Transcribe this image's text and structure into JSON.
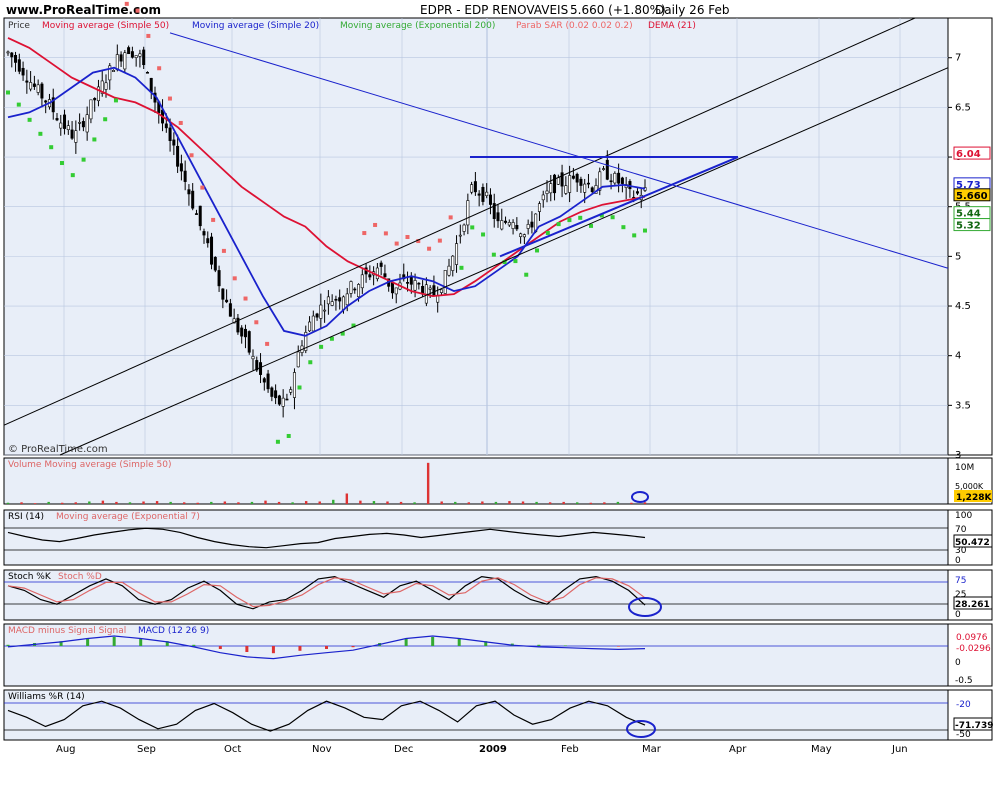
{
  "header": {
    "site": "www.ProRealTime.com",
    "title": "EDPR - EDP RENOVAVEIS",
    "quote": "5.660 (+1.80%)",
    "period": "Daily  26 Feb"
  },
  "legend": {
    "price": "Price",
    "sma50": "Moving average (Simple 50)",
    "sma20": "Moving average (Simple 20)",
    "ema200": "Moving average (Exponential 200)",
    "sar": "Parab SAR (0.02 0.02 0.2)",
    "dema": "DEMA (21)"
  },
  "colors": {
    "panel_bg": "#e8eef8",
    "grid": "#b8c6e0",
    "up_candle": "#ffffff",
    "down_candle": "#000000",
    "sma50": "#dd1133",
    "sma20": "#1a22cc",
    "sar_up": "#33cc33",
    "sar_down": "#ee6666",
    "trend_blue": "#1a22cc",
    "label_price": "#ffcc00"
  },
  "watermark": "© ProRealTime.com",
  "chart_data": [
    {
      "type": "candlestick",
      "panel": "price",
      "x": [
        "Aug",
        "Sep",
        "Oct",
        "Nov",
        "Dec",
        "2009",
        "Feb",
        "Mar",
        "Apr",
        "May",
        "Jun"
      ],
      "ylim": [
        3,
        7.4
      ],
      "yticks": [
        3,
        3.5,
        4,
        4.5,
        5,
        5.5,
        6,
        6.5,
        7
      ],
      "close_path": [
        7.05,
        6.9,
        6.7,
        6.55,
        6.35,
        6.2,
        6.45,
        6.7,
        6.95,
        7.1,
        7.0,
        6.6,
        6.2,
        5.9,
        5.5,
        5.1,
        4.7,
        4.35,
        4.1,
        3.8,
        3.55,
        3.5,
        4.1,
        4.4,
        4.55,
        4.6,
        4.7,
        4.8,
        4.9,
        4.65,
        4.75,
        4.7,
        4.6,
        4.8,
        5.2,
        5.7,
        5.6,
        5.3,
        5.4,
        5.2,
        5.5,
        5.7,
        5.75,
        5.8,
        5.7,
        5.85,
        5.75,
        5.6,
        5.66
      ],
      "series": [
        {
          "name": "Moving average (Simple 50)",
          "values": [
            7.2,
            7.1,
            6.95,
            6.8,
            6.7,
            6.6,
            6.55,
            6.45,
            6.3,
            6.1,
            5.9,
            5.7,
            5.55,
            5.4,
            5.3,
            5.1,
            4.95,
            4.85,
            4.75,
            4.65,
            4.6,
            4.62,
            4.75,
            4.9,
            5.05,
            5.2,
            5.35,
            5.45,
            5.52,
            5.56,
            5.6
          ]
        },
        {
          "name": "Moving average (Simple 20)",
          "values": [
            6.4,
            6.45,
            6.55,
            6.7,
            6.85,
            6.9,
            6.8,
            6.6,
            6.2,
            5.8,
            5.4,
            5.0,
            4.6,
            4.25,
            4.2,
            4.3,
            4.5,
            4.65,
            4.75,
            4.8,
            4.75,
            4.65,
            4.7,
            4.85,
            5.0,
            5.3,
            5.4,
            5.55,
            5.7,
            5.72,
            5.68
          ]
        },
        {
          "name": "Parab SAR (0.02 0.02 0.2)",
          "values": []
        }
      ],
      "trend_lines": [
        {
          "name": "horizontal-resistance",
          "value": 6.0
        },
        {
          "name": "descending-resistance",
          "from": 7.2,
          "to": 4.9
        }
      ],
      "price_labels": [
        "6.04",
        "5.73",
        "5.660",
        "5.44",
        "5.32"
      ]
    },
    {
      "type": "bar",
      "panel": "volume",
      "title": "Volume Moving average (Simple 50)",
      "yticks": [
        "10M",
        "5,000K"
      ],
      "last_label": "1,228K",
      "values": [
        0.3,
        0.4,
        0.2,
        0.5,
        0.3,
        0.4,
        0.6,
        0.8,
        0.5,
        0.4,
        0.6,
        0.7,
        0.5,
        0.4,
        0.3,
        0.5,
        0.6,
        0.4,
        0.5,
        0.8,
        0.5,
        0.4,
        0.7,
        0.6,
        1.0,
        2.5,
        0.8,
        0.7,
        0.6,
        0.5,
        0.4,
        9.8,
        0.6,
        0.5,
        0.4,
        0.6,
        0.5,
        0.7,
        0.6,
        0.5,
        0.4,
        0.5,
        0.4,
        0.3,
        0.4,
        0.5,
        0.3,
        0.4
      ]
    },
    {
      "type": "line",
      "panel": "rsi",
      "title": "RSI (14)",
      "subtitle": "Moving average (Exponential 7)",
      "yticks": [
        "100",
        "70",
        "30",
        "0"
      ],
      "last_label": "50.472",
      "values": [
        60,
        52,
        45,
        42,
        48,
        55,
        60,
        65,
        68,
        66,
        60,
        50,
        42,
        36,
        32,
        30,
        34,
        38,
        40,
        48,
        52,
        56,
        58,
        55,
        50,
        54,
        58,
        62,
        66,
        62,
        58,
        55,
        52,
        56,
        60,
        57,
        54,
        50
      ]
    },
    {
      "type": "area",
      "panel": "stochastic",
      "title": "Stoch %K",
      "subtitle": "Stoch %D",
      "yticks": [
        "75",
        "25",
        "0"
      ],
      "last_label": "28.261",
      "values": [
        70,
        60,
        40,
        30,
        50,
        70,
        85,
        70,
        40,
        30,
        40,
        65,
        80,
        60,
        30,
        20,
        35,
        40,
        60,
        85,
        90,
        75,
        60,
        45,
        70,
        80,
        60,
        40,
        70,
        90,
        85,
        60,
        40,
        30,
        60,
        85,
        90,
        80,
        60,
        28
      ]
    },
    {
      "type": "bar",
      "panel": "macd",
      "title": "MACD minus Signal Signal",
      "subtitle": "MACD (12 26 9)",
      "yticks": [
        "0",
        "-0.5"
      ],
      "last_labels": [
        "0.0976",
        "-0.0296"
      ],
      "values": [
        0.02,
        0.05,
        0.08,
        0.12,
        0.15,
        0.12,
        0.08,
        0.02,
        -0.05,
        -0.1,
        -0.12,
        -0.08,
        -0.05,
        -0.02,
        0.05,
        0.12,
        0.15,
        0.12,
        0.08,
        0.04,
        0.02,
        0.01,
        0.0,
        -0.01,
        0.0
      ]
    },
    {
      "type": "line",
      "panel": "williams",
      "title": "Williams %R (14)",
      "yticks": [
        "-20",
        "-50"
      ],
      "last_label": "-71.739",
      "values": [
        -40,
        -55,
        -75,
        -60,
        -30,
        -20,
        -35,
        -60,
        -80,
        -70,
        -40,
        -25,
        -45,
        -70,
        -85,
        -70,
        -40,
        -20,
        -35,
        -55,
        -60,
        -30,
        -20,
        -40,
        -65,
        -30,
        -20,
        -50,
        -70,
        -60,
        -35,
        -20,
        -30,
        -55,
        -72
      ]
    }
  ],
  "time_axis": [
    "Aug",
    "Sep",
    "Oct",
    "Nov",
    "Dec",
    "2009",
    "Feb",
    "Mar",
    "Apr",
    "May",
    "Jun"
  ]
}
